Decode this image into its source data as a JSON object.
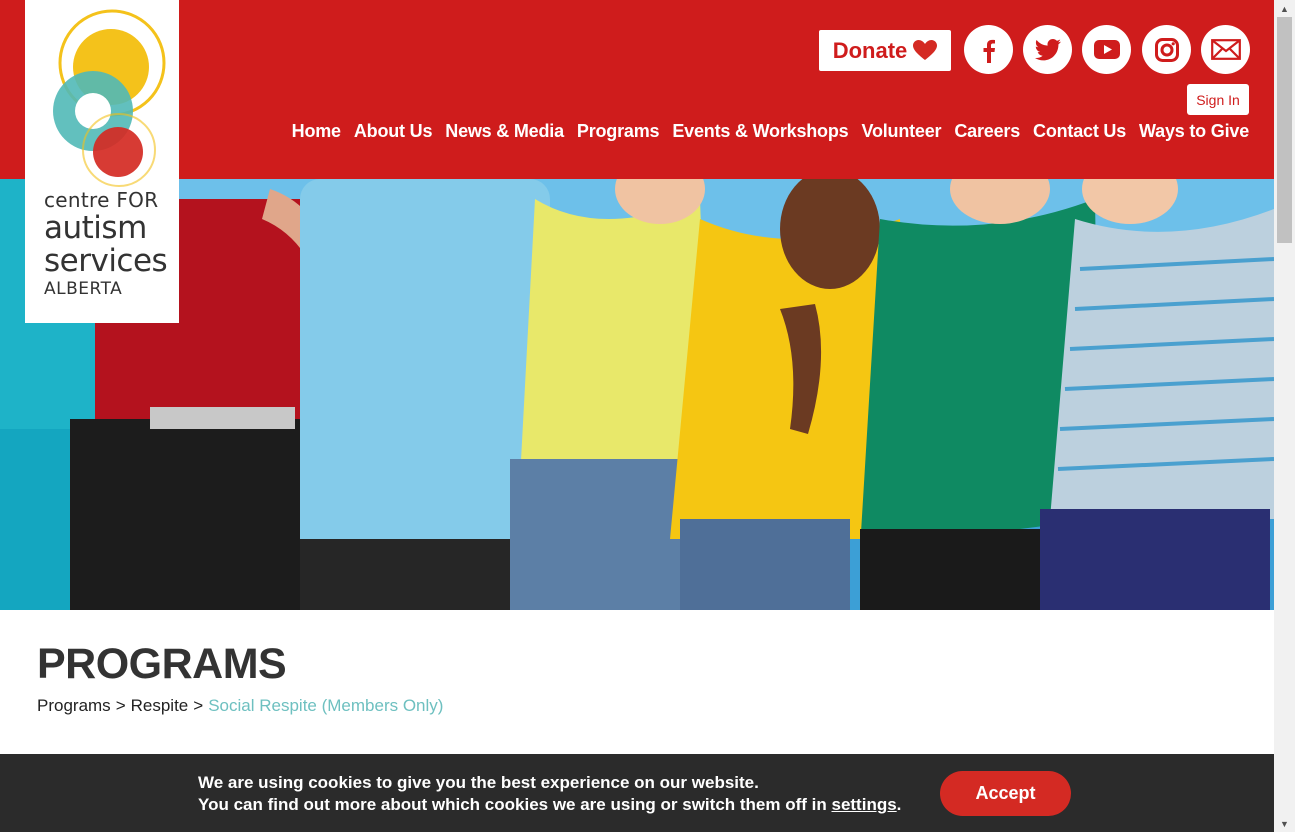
{
  "logo": {
    "line1": "centre FOR",
    "line2": "autism",
    "line3": "services",
    "line4": "ALBERTA",
    "colors": {
      "yellow": "#f4c21b",
      "teal": "#51b9b7",
      "red": "#d42a23"
    }
  },
  "header": {
    "donate_label": "Donate",
    "sign_in_label": "Sign In",
    "social": [
      {
        "name": "facebook-icon",
        "glyph": "f"
      },
      {
        "name": "twitter-icon",
        "glyph": "bird"
      },
      {
        "name": "youtube-icon",
        "glyph": "play"
      },
      {
        "name": "instagram-icon",
        "glyph": "camera"
      },
      {
        "name": "email-icon",
        "glyph": "envelope"
      }
    ],
    "nav": [
      "Home",
      "About Us",
      "News & Media",
      "Programs",
      "Events & Workshops",
      "Volunteer",
      "Careers",
      "Contact Us",
      "Ways to Give"
    ]
  },
  "page": {
    "title": "PROGRAMS",
    "breadcrumb": [
      "Programs",
      "Respite",
      "Social Respite (Members Only)"
    ],
    "breadcrumb_separator": ">"
  },
  "cookie": {
    "line1": "We are using cookies to give you the best experience on our website.",
    "line2_prefix": "You can find out more about which cookies we are using or switch them off in ",
    "settings_link": "settings",
    "line2_suffix": ".",
    "accept_label": "Accept"
  },
  "colors": {
    "brand_red": "#cf1c1c",
    "cookie_bg": "#2b2b2b",
    "breadcrumb_current": "#6ec0c0",
    "title": "#333333"
  }
}
